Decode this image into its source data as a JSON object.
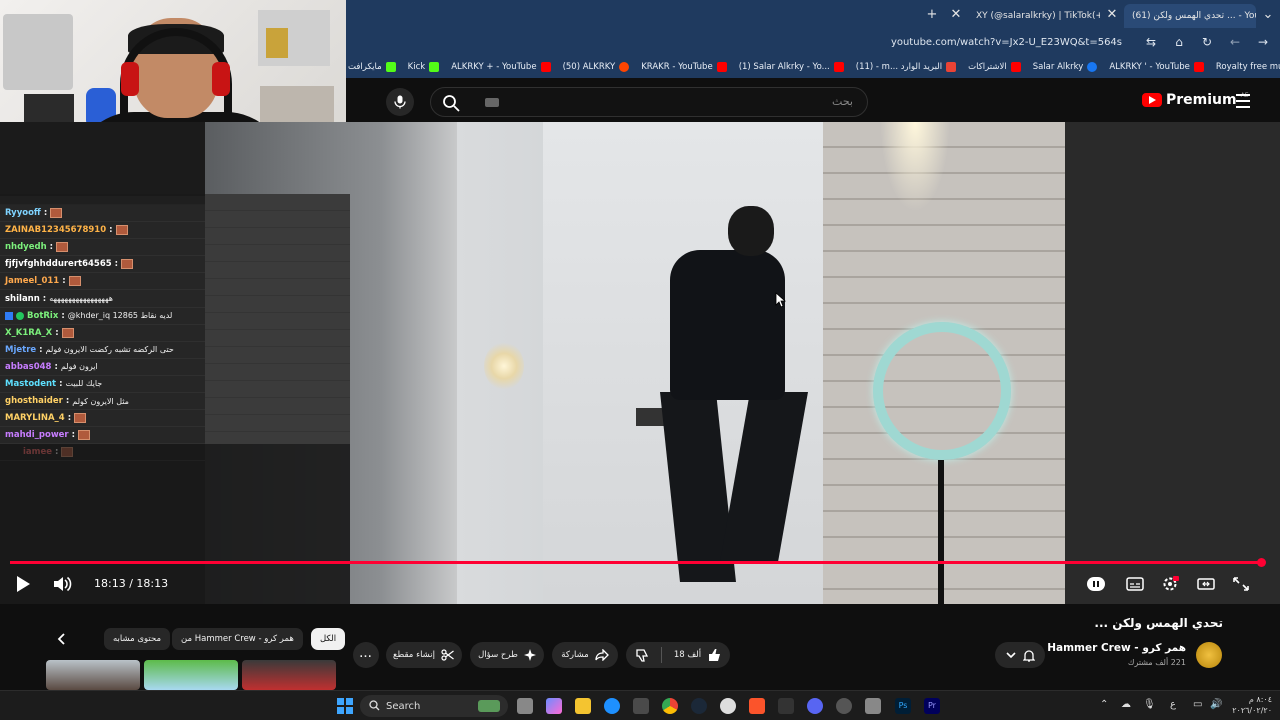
{
  "browser": {
    "tabs": [
      {
        "label": "XY (@salaralkrky) | TikTok(+99)",
        "favicon": "tiktok-icon"
      },
      {
        "label": "(61) تحدي الهمس ولكن ... - YouTube",
        "favicon": "youtube-icon"
      }
    ],
    "url": "youtube.com/watch?v=Jx2-U_E23WQ&t=564s",
    "bookmarks": [
      {
        "label": "مايكرافت",
        "icon": "kick-icon",
        "color": "#53fc18"
      },
      {
        "label": "Kick",
        "icon": "kick-icon",
        "color": "#53fc18"
      },
      {
        "label": "ALKRKY + - YouTube",
        "icon": "youtube-icon",
        "color": "#ff0000"
      },
      {
        "label": "(50) ALKRKY",
        "icon": "reddit-icon",
        "color": "#ff4500"
      },
      {
        "label": "KRAKR - YouTube",
        "icon": "youtube-icon",
        "color": "#ff0000"
      },
      {
        "label": "(1) Salar Alkrky - Yo...",
        "icon": "youtube-icon",
        "color": "#ff0000"
      },
      {
        "label": "(11) - m... البريد الوارد",
        "icon": "gmail-icon",
        "color": "#ea4335"
      },
      {
        "label": "الاشتراكات",
        "icon": "youtube-icon",
        "color": "#ff0000"
      },
      {
        "label": "Salar Alkrky",
        "icon": "facebook-icon",
        "color": "#1877f2"
      },
      {
        "label": "ALKRKY ' - YouTube",
        "icon": "youtube-icon",
        "color": "#ff0000"
      },
      {
        "label": "Royalty free music |...",
        "icon": "music-icon",
        "color": "#ffffff"
      }
    ]
  },
  "youtube": {
    "search_placeholder": "بحث",
    "logo_text": "Premium",
    "region": "AE"
  },
  "chat": {
    "messages": [
      {
        "user": "Ryyooff",
        "color": "#7fd3ff",
        "text": "",
        "emote": true
      },
      {
        "user": "ZAINAB12345678910",
        "color": "#ffb347",
        "text": "",
        "emote": true
      },
      {
        "user": "nhdyedh",
        "color": "#7cf07c",
        "text": "",
        "emote": true
      },
      {
        "user": "fjfjvfghhddurert64565",
        "color": "#ffffff",
        "text": "",
        "emote": true
      },
      {
        "user": "Jameel_011",
        "color": "#ffa94d",
        "text": "",
        "emote": true
      },
      {
        "user": "shilann",
        "color": "#ffffff",
        "text": "ههههههههههههههههه",
        "emote": false
      },
      {
        "user": "BotRix",
        "color": "#7cf07c",
        "text": "@khder_iq 12865 لديه نقاط",
        "emote": false
      },
      {
        "user": "X_K1RA_X",
        "color": "#7cf07c",
        "text": "",
        "emote": true
      },
      {
        "user": "Mjetre",
        "color": "#6aa8ff",
        "text": "حتى الركضه تشبه ركضت الايرون فولم",
        "emote": false
      },
      {
        "user": "abbas048",
        "color": "#c77dff",
        "text": "ايرون فولم",
        "emote": false
      },
      {
        "user": "Mastodent",
        "color": "#5ee0ff",
        "text": "جايك للبيت",
        "emote": false
      },
      {
        "user": "ghosthaider",
        "color": "#ffd166",
        "text": "مثل الايرون كولم",
        "emote": false
      },
      {
        "user": "MARYLINA_4",
        "color": "#ffd166",
        "text": "",
        "emote": true
      },
      {
        "user": "mahdi_power",
        "color": "#c77dff",
        "text": "",
        "emote": true
      },
      {
        "user": "iamee",
        "color": "#ff6b6b",
        "text": "",
        "emote": true
      }
    ]
  },
  "player": {
    "time": "18:13 / 18:13",
    "progress_fraction": 1.0
  },
  "video": {
    "title": "تحدي الهمس ولكن ...",
    "channel": "Hammer Crew - همر كرو",
    "subscribers": "221 ألف مشترك",
    "likes": "18 ألف",
    "share_label": "مشاركة",
    "ask_label": "طرح سؤال",
    "clip_label": "إنشاء مقطع",
    "more_label": "...",
    "chips": [
      {
        "label": "الكل",
        "active": true
      },
      {
        "label": "من Hammer Crew - همر كرو",
        "active": false
      },
      {
        "label": "محتوى مشابه",
        "active": false
      }
    ]
  },
  "taskbar": {
    "search_label": "Search",
    "lang": "ع",
    "time": "٨:٠٤ م",
    "date": "٢٠٢٦/٠٢/٢٠"
  }
}
